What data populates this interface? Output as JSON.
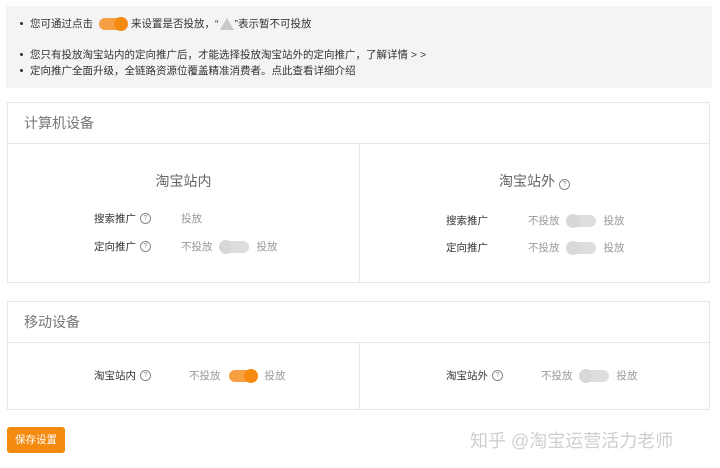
{
  "notice": {
    "line1_prefix": "您可通过点击",
    "line1_middle": "来设置是否投放，“",
    "line1_suffix": "”表示暂不可投放",
    "line2": "您只有投放淘宝站内的定向推广后，才能选择投放淘宝站外的定向推广，了解详情 > >",
    "line3": "定向推广全面升级，全链路资源位覆盖精准消费者。点此查看详细介绍",
    "toggle_demo": "on",
    "warning_icon": "warning-triangle-icon"
  },
  "computer": {
    "title": "计算机设备",
    "inside": {
      "title": "淘宝站内",
      "search_label": "搜索推广",
      "search_value": "投放",
      "directed_label": "定向推广",
      "directed_off": "不投放",
      "directed_on": "投放",
      "directed_state": "off"
    },
    "outside": {
      "title": "淘宝站外",
      "search_label": "搜索推广",
      "search_off": "不投放",
      "search_on": "投放",
      "search_state": "off",
      "directed_label": "定向推广",
      "directed_off": "不投放",
      "directed_on": "投放",
      "directed_state": "off"
    }
  },
  "mobile": {
    "title": "移动设备",
    "inside": {
      "label": "淘宝站内",
      "off": "不投放",
      "on": "投放",
      "state": "on"
    },
    "outside": {
      "label": "淘宝站外",
      "off": "不投放",
      "on": "投放",
      "state": "off"
    }
  },
  "save_button": "保存设置",
  "watermark": "知乎 @淘宝运营活力老师",
  "colors": {
    "accent": "#f58a10",
    "toggle_off": "#dddddd",
    "panel_bg": "#f4f4f4"
  }
}
